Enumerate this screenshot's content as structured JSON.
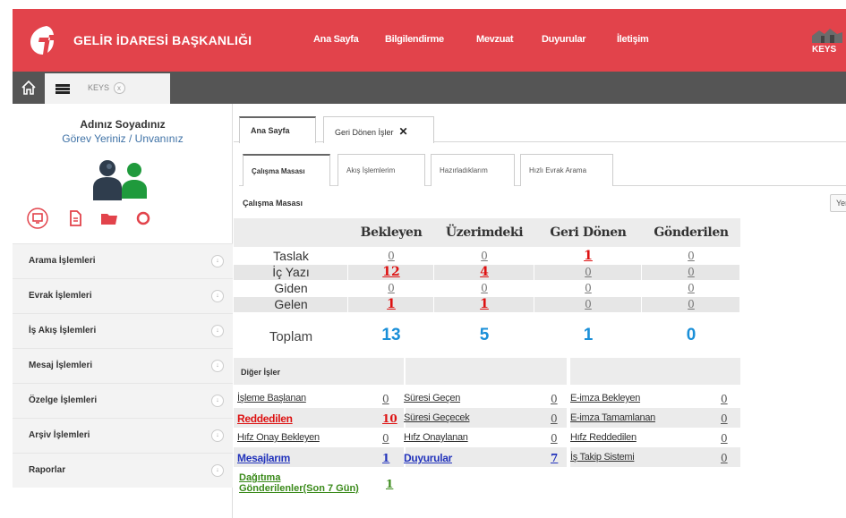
{
  "header": {
    "brand": "GELİR İDARESİ BAŞKANLIĞI",
    "nav": [
      "Ana Sayfa",
      "Bilgilendirme",
      "Mevzuat",
      "Duyurular",
      "İletişim"
    ],
    "right_logo_text": "KEYS",
    "accent_color": "#e2434b"
  },
  "tabbar": {
    "app_tab": "KEYS",
    "close_symbol": "x"
  },
  "sidebar": {
    "user_name": "Adınız Soyadınız",
    "user_title": "Görev Yeriniz / Unvanınız",
    "menu": [
      "Arama İşlemleri",
      "Evrak İşlemleri",
      "İş Akış İşlemleri",
      "Mesaj İşlemleri",
      "Özelge İşlemleri",
      "Arşiv İşlemleri",
      "Raporlar"
    ]
  },
  "main": {
    "tabs": [
      {
        "label": "Ana Sayfa",
        "active": true
      },
      {
        "label": "Geri Dönen İşler",
        "close": "✕"
      }
    ],
    "subtabs": [
      {
        "label": "Çalışma Masası",
        "active": true
      },
      {
        "label": "Akış İşlemlerim"
      },
      {
        "label": "Hazırladıklarım"
      },
      {
        "label": "Hızlı Evrak Arama"
      }
    ],
    "section_title": "Çalışma Masası",
    "refresh_label": "Yenile",
    "summary": {
      "columns": [
        "Bekleyen",
        "Üzerimdeki",
        "Geri Dönen",
        "Gönderilen"
      ],
      "rows": [
        {
          "label": "Taslak",
          "values": [
            "0",
            "0",
            "1",
            "0"
          ],
          "red": [
            false,
            false,
            true,
            false
          ]
        },
        {
          "label": "İç Yazı",
          "values": [
            "12",
            "4",
            "0",
            "0"
          ],
          "red": [
            true,
            true,
            false,
            false
          ]
        },
        {
          "label": "Giden",
          "values": [
            "0",
            "0",
            "0",
            "0"
          ],
          "red": [
            false,
            false,
            false,
            false
          ]
        },
        {
          "label": "Gelen",
          "values": [
            "1",
            "1",
            "0",
            "0"
          ],
          "red": [
            true,
            true,
            false,
            false
          ]
        }
      ],
      "total_label": "Toplam",
      "totals": [
        "13",
        "5",
        "1",
        "0"
      ]
    },
    "other": {
      "title": "Diğer İşler",
      "rows": [
        [
          {
            "label": "İşleme Başlanan",
            "count": "0"
          },
          {
            "label": "Süresi Geçen",
            "count": "0"
          },
          {
            "label": "E-imza Bekleyen",
            "count": "0"
          }
        ],
        [
          {
            "label": "Reddedilen",
            "count": "10",
            "style": "red"
          },
          {
            "label": "Süresi Geçecek",
            "count": "0"
          },
          {
            "label": "E-imza Tamamlanan",
            "count": "0"
          }
        ],
        [
          {
            "label": "Hıfz Onay Bekleyen",
            "count": "0"
          },
          {
            "label": "Hıfz Onaylanan",
            "count": "0"
          },
          {
            "label": "Hıfz Reddedilen",
            "count": "0"
          }
        ],
        [
          {
            "label": "Mesajlarım",
            "count": "1",
            "style": "blue"
          },
          {
            "label": "Duyurular",
            "count": "7",
            "style": "blue"
          },
          {
            "label": "İş Takip Sistemi",
            "count": "0"
          }
        ]
      ],
      "distributed": {
        "label": "Dağıtıma Gönderilenler(Son 7 Gün)",
        "count": "1"
      }
    }
  }
}
